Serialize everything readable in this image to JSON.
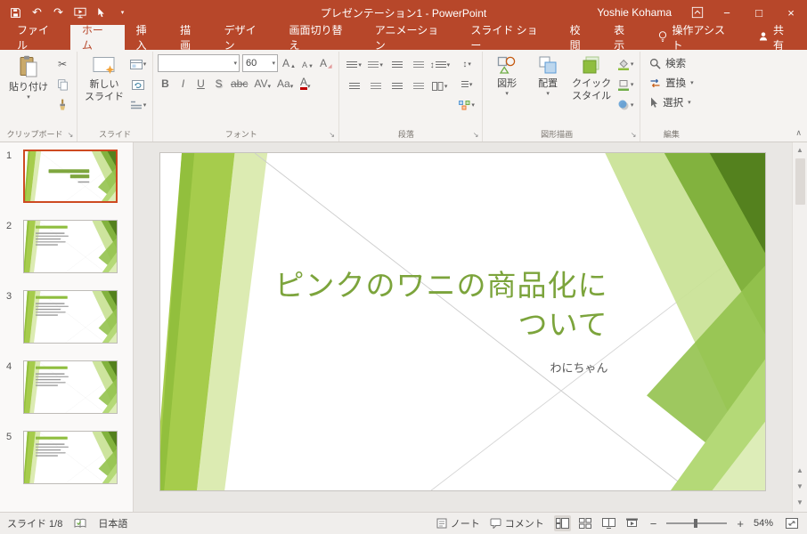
{
  "window": {
    "title": "プレゼンテーション1 - PowerPoint",
    "user": "Yoshie Kohama"
  },
  "icons": {
    "dropdown_caret": "▾",
    "undo": "↶",
    "redo": "↷",
    "minimize": "−",
    "maximize": "□",
    "close": "×",
    "cut": "✂",
    "launcher": "↘",
    "collapse_ribbon": "∧",
    "scroll_up": "▲",
    "scroll_down": "▼",
    "prev_slide": "▲",
    "next_slide": "▼",
    "zoom_out": "−",
    "zoom_in": "+",
    "updown": "↕"
  },
  "tabs": [
    {
      "label": "ファイル"
    },
    {
      "label": "ホーム"
    },
    {
      "label": "挿入"
    },
    {
      "label": "描画"
    },
    {
      "label": "デザイン"
    },
    {
      "label": "画面切り替え"
    },
    {
      "label": "アニメーション"
    },
    {
      "label": "スライド ショー"
    },
    {
      "label": "校閲"
    },
    {
      "label": "表示"
    }
  ],
  "tellme": "操作アシスト",
  "share": "共有",
  "ribbon": {
    "clipboard": {
      "paste": "貼り付け",
      "label": "クリップボード"
    },
    "slides": {
      "new1": "新しい",
      "new2": "スライド",
      "label": "スライド"
    },
    "font": {
      "size": "60",
      "grow": "A",
      "shrink": "A",
      "clear": "A",
      "bold": "B",
      "italic": "I",
      "underline": "U",
      "shadow": "S",
      "strike": "abc",
      "spacing": "AV",
      "case_btn": "Aa",
      "color": "A",
      "label": "フォント"
    },
    "paragraph": {
      "label": "段落"
    },
    "drawing": {
      "shapes": "図形",
      "arrange": "配置",
      "quick1": "クイック",
      "quick2": "スタイル",
      "label": "図形描画"
    },
    "editing": {
      "find": "検索",
      "replace": "置換",
      "select": "選択",
      "label": "編集"
    }
  },
  "slide": {
    "title_line1": "ピンクのワニの商品化に",
    "title_line2": "ついて",
    "subtitle": "わにちゃん"
  },
  "thumbnails": [
    {
      "number": "1"
    },
    {
      "number": "2"
    },
    {
      "number": "3"
    },
    {
      "number": "4"
    },
    {
      "number": "5"
    }
  ],
  "statusbar": {
    "slide_indicator": "スライド 1/8",
    "language": "日本語",
    "notes": "ノート",
    "comments": "コメント",
    "zoom_level": "54%"
  }
}
